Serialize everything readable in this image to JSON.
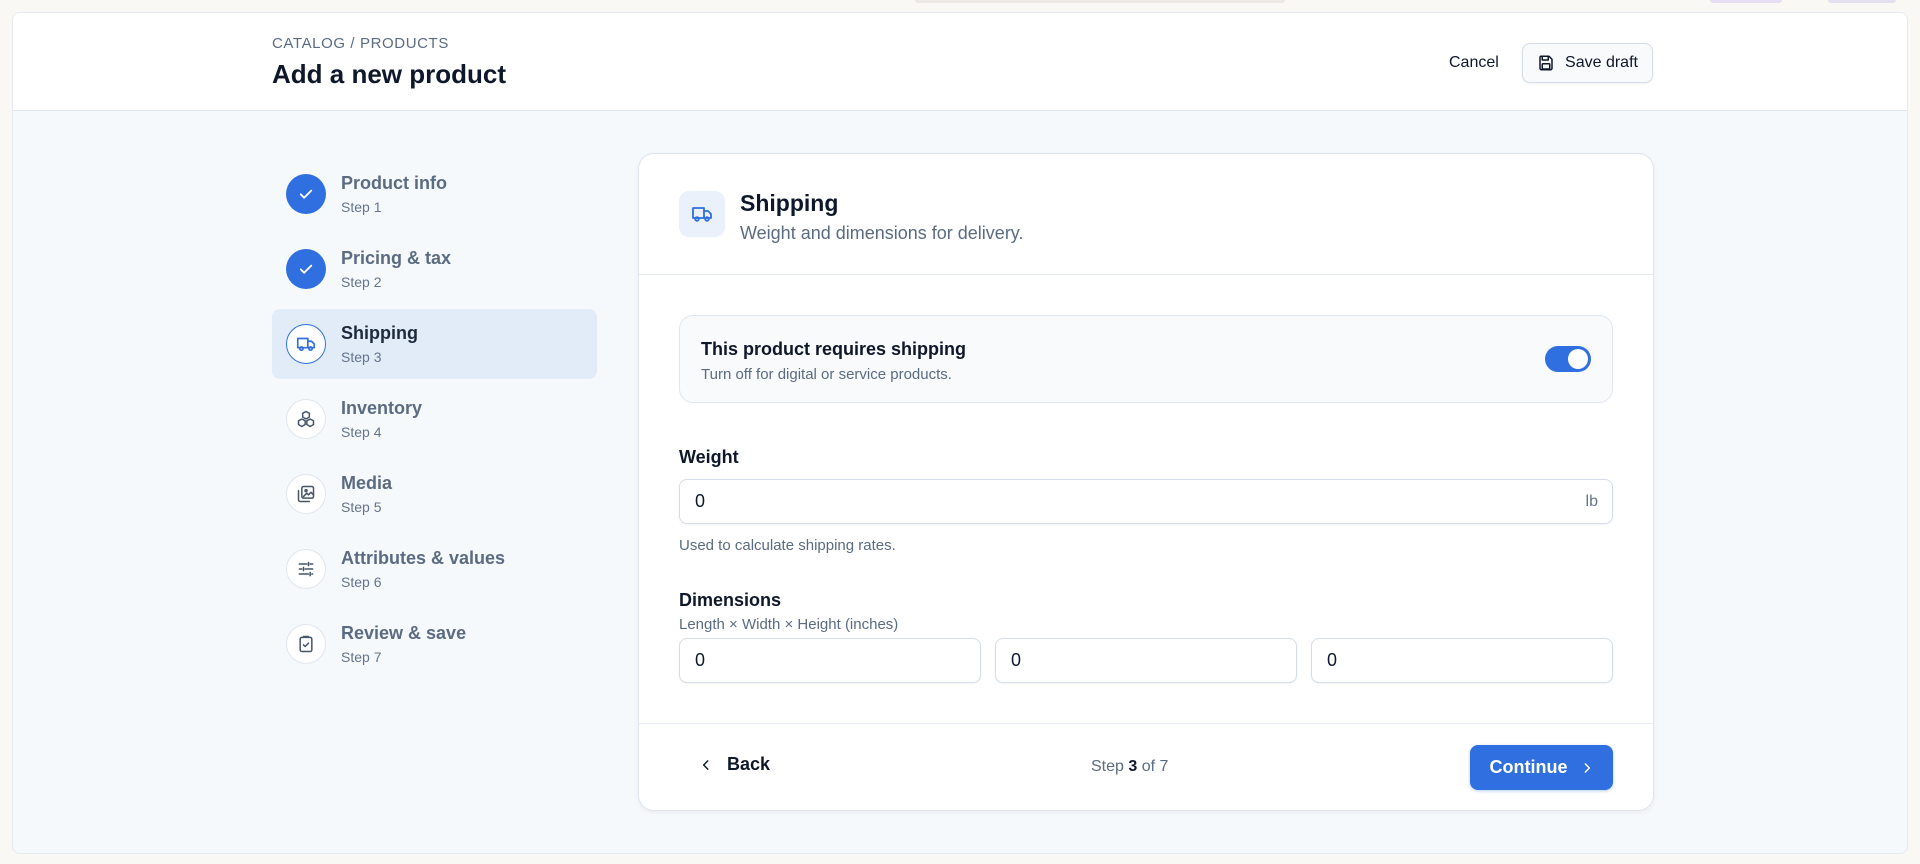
{
  "header": {
    "breadcrumb": "CATALOG / PRODUCTS",
    "title": "Add a new product",
    "cancel_label": "Cancel",
    "save_draft_label": "Save draft"
  },
  "stepper": {
    "steps": [
      {
        "label": "Product info",
        "sub": "Step 1",
        "status": "done",
        "icon": "check-icon"
      },
      {
        "label": "Pricing & tax",
        "sub": "Step 2",
        "status": "done",
        "icon": "check-icon"
      },
      {
        "label": "Shipping",
        "sub": "Step 3",
        "status": "current",
        "icon": "truck-icon"
      },
      {
        "label": "Inventory",
        "sub": "Step 4",
        "status": "todo",
        "icon": "boxes-icon"
      },
      {
        "label": "Media",
        "sub": "Step 5",
        "status": "todo",
        "icon": "images-icon"
      },
      {
        "label": "Attributes & values",
        "sub": "Step 6",
        "status": "todo",
        "icon": "sliders-icon"
      },
      {
        "label": "Review & save",
        "sub": "Step 7",
        "status": "todo",
        "icon": "clipboard-check-icon"
      }
    ]
  },
  "card": {
    "title": "Shipping",
    "subtitle": "Weight and dimensions for delivery.",
    "shipping_toggle": {
      "title": "This product requires shipping",
      "subtitle": "Turn off for digital or service products.",
      "on": true
    },
    "weight": {
      "label": "Weight",
      "value": "0",
      "unit": "lb",
      "hint": "Used to calculate shipping rates."
    },
    "dimensions": {
      "label": "Dimensions",
      "hint": "Length × Width × Height (inches)",
      "length": "0",
      "width": "0",
      "height": "0"
    },
    "footer": {
      "back_label": "Back",
      "step_prefix": "Step",
      "step_current": "3",
      "step_of": "of 7",
      "continue_label": "Continue"
    }
  },
  "colors": {
    "accent": "#2f6fdf",
    "active_step_bg": "#e2ecf8",
    "page_bg": "#f6f9fc"
  }
}
